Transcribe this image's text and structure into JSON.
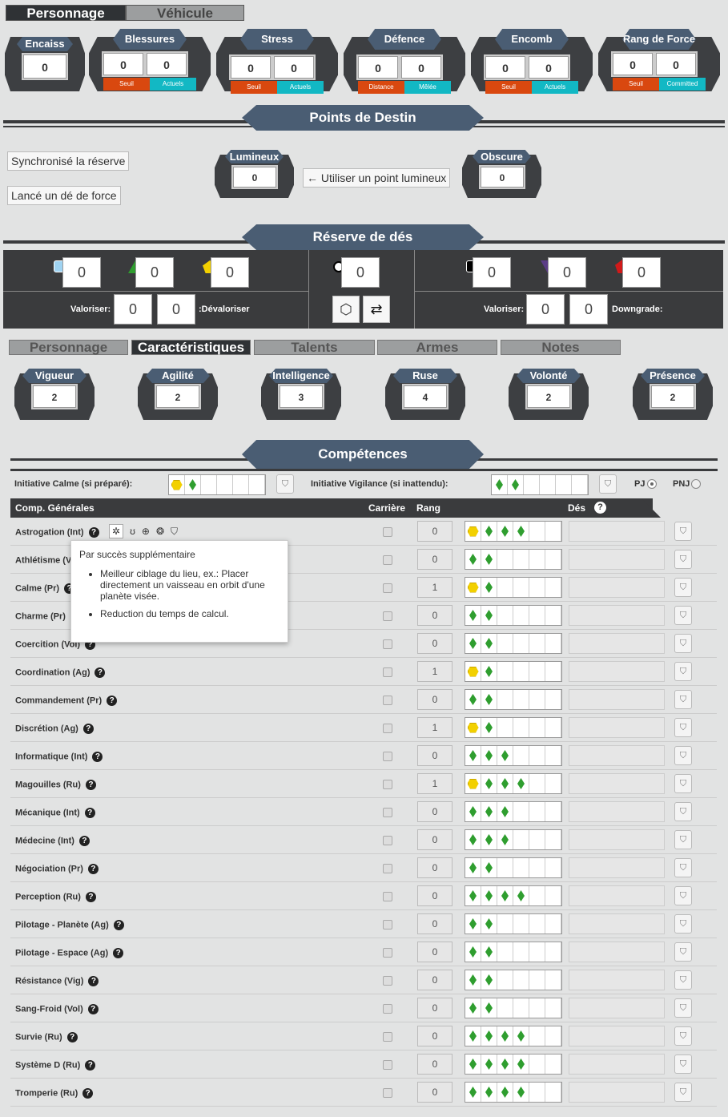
{
  "tabs": {
    "personnage": "Personnage",
    "vehicule": "Véhicule"
  },
  "stats": [
    {
      "label": "Encaiss",
      "value": "0"
    },
    {
      "label": "Blessures",
      "v1": "0",
      "v2": "0",
      "s1": "Seuil",
      "s2": "Actuels"
    },
    {
      "label": "Stress",
      "v1": "0",
      "v2": "0",
      "s1": "Seuil",
      "s2": "Actuels"
    },
    {
      "label": "Défence",
      "v1": "0",
      "v2": "0",
      "s1": "Distance",
      "s2": "Mêlée"
    },
    {
      "label": "Encomb",
      "v1": "0",
      "v2": "0",
      "s1": "Seuil",
      "s2": "Actuels"
    },
    {
      "label": "Rang de Force",
      "v1": "0",
      "v2": "0",
      "s1": "Seuil",
      "s2": "Committed"
    }
  ],
  "destiny": {
    "title": "Points de Destin",
    "sync": "Synchronisé la réserve",
    "roll_force": "Lancé un dé de force",
    "light_label": "Lumineux",
    "light": "0",
    "use_light": "← Utiliser un point lumineux",
    "dark_label": "Obscure",
    "dark": "0"
  },
  "pool": {
    "title": "Réserve de dés",
    "left": [
      "0",
      "0",
      "0"
    ],
    "mid": "0",
    "right": [
      "0",
      "0",
      "0"
    ],
    "valoriser": "Valoriser:",
    "devaloriser": ":Dévaloriser",
    "lv1": "0",
    "lv2": "0",
    "rv1": "0",
    "rv2": "0",
    "downgrade": "Downgrade:"
  },
  "chartabs": [
    "Personnage",
    "Caractéristiques",
    "Talents",
    "Armes",
    "Notes"
  ],
  "characteristics": [
    {
      "label": "Vigueur",
      "value": "2"
    },
    {
      "label": "Agilité",
      "value": "2"
    },
    {
      "label": "Intelligence",
      "value": "3"
    },
    {
      "label": "Ruse",
      "value": "4"
    },
    {
      "label": "Volonté",
      "value": "2"
    },
    {
      "label": "Présence",
      "value": "2"
    }
  ],
  "skills_title": "Compétences",
  "initiative": {
    "calme": "Initiative Calme (si préparé):",
    "vigilance": "Initiative Vigilance (si inattendu):",
    "pj": "PJ",
    "pnj": "PNJ"
  },
  "headers": {
    "general": "Comp. Générales",
    "career": "Carrière",
    "rank": "Rang",
    "dice": "Dés"
  },
  "skills": [
    {
      "name": "Astrogation (Int)",
      "rank": "0",
      "y": 1,
      "g": 3
    },
    {
      "name": "Athlétisme (Vig)",
      "rank": "0",
      "y": 0,
      "g": 2
    },
    {
      "name": "Calme (Pr)",
      "rank": "1",
      "y": 1,
      "g": 1
    },
    {
      "name": "Charme (Pr)",
      "rank": "0",
      "y": 0,
      "g": 2
    },
    {
      "name": "Coercition (Vol)",
      "rank": "0",
      "y": 0,
      "g": 2
    },
    {
      "name": "Coordination (Ag)",
      "rank": "1",
      "y": 1,
      "g": 1
    },
    {
      "name": "Commandement (Pr)",
      "rank": "0",
      "y": 0,
      "g": 2
    },
    {
      "name": "Discrétion (Ag)",
      "rank": "1",
      "y": 1,
      "g": 1
    },
    {
      "name": "Informatique (Int)",
      "rank": "0",
      "y": 0,
      "g": 3
    },
    {
      "name": "Magouilles (Ru)",
      "rank": "1",
      "y": 1,
      "g": 3
    },
    {
      "name": "Mécanique (Int)",
      "rank": "0",
      "y": 0,
      "g": 3
    },
    {
      "name": "Médecine (Int)",
      "rank": "0",
      "y": 0,
      "g": 3
    },
    {
      "name": "Négociation (Pr)",
      "rank": "0",
      "y": 0,
      "g": 2
    },
    {
      "name": "Perception (Ru)",
      "rank": "0",
      "y": 0,
      "g": 4
    },
    {
      "name": "Pilotage - Planète (Ag)",
      "rank": "0",
      "y": 0,
      "g": 2
    },
    {
      "name": "Pilotage - Espace (Ag)",
      "rank": "0",
      "y": 0,
      "g": 2
    },
    {
      "name": "Résistance (Vig)",
      "rank": "0",
      "y": 0,
      "g": 2
    },
    {
      "name": "Sang-Froid (Vol)",
      "rank": "0",
      "y": 0,
      "g": 2
    },
    {
      "name": "Survie (Ru)",
      "rank": "0",
      "y": 0,
      "g": 4
    },
    {
      "name": "Système D (Ru)",
      "rank": "0",
      "y": 0,
      "g": 4
    },
    {
      "name": "Tromperie (Ru)",
      "rank": "0",
      "y": 0,
      "g": 4
    }
  ],
  "tooltip": {
    "title": "Par succès supplémentaire",
    "items": [
      "Meilleur ciblage du lieu, ex.: Placer directement un vaisseau en orbit d'une planète visée.",
      "Reduction du temps de calcul."
    ]
  },
  "colors": {
    "slate": "#4a5d73",
    "dark": "#3a3b3d",
    "orange": "#d9480f",
    "cyan": "#12b8c4",
    "green": "#2f9e2f",
    "yellow": "#f2d000"
  }
}
